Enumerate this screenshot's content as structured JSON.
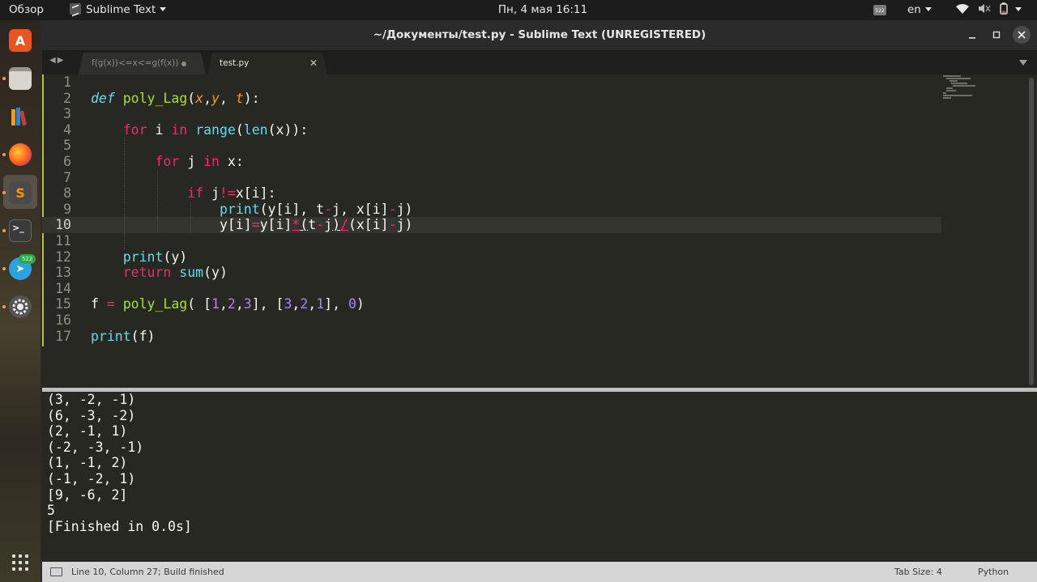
{
  "topbar": {
    "overview": "Обзор",
    "app_name": "Sublime Text",
    "clock": "Пн, 4 мая  16:11",
    "tray_badge": "522",
    "language": "en"
  },
  "dock": {
    "items": [
      "ubuntu-software",
      "files",
      "libreoffice",
      "firefox",
      "sublime-text",
      "terminal",
      "telegram",
      "settings"
    ],
    "telegram_badge": "522"
  },
  "window": {
    "title": "~/Документы/test.py - Sublime Text (UNREGISTERED)",
    "tabs": [
      {
        "label": "f(g(x))<=x<=g(f(x))",
        "modified": true
      },
      {
        "label": "test.py",
        "active": true
      }
    ]
  },
  "editor": {
    "line_numbers": [
      "1",
      "2",
      "3",
      "4",
      "5",
      "6",
      "7",
      "8",
      "9",
      "10",
      "11",
      "12",
      "13",
      "14",
      "15",
      "16",
      "17"
    ],
    "current_line": 10
  },
  "output": {
    "lines": [
      "(3, -2, -1)",
      "(6, -3, -2)",
      "(2, -1, 1)",
      "(-2, -3, -1)",
      "(1, -1, 2)",
      "(-1, -2, 1)",
      "[9, -6, 2]",
      "5",
      "[Finished in 0.0s]"
    ]
  },
  "statusbar": {
    "position": "Line 10, Column 27; Build finished",
    "tab_size": "Tab Size: 4",
    "syntax": "Python"
  }
}
